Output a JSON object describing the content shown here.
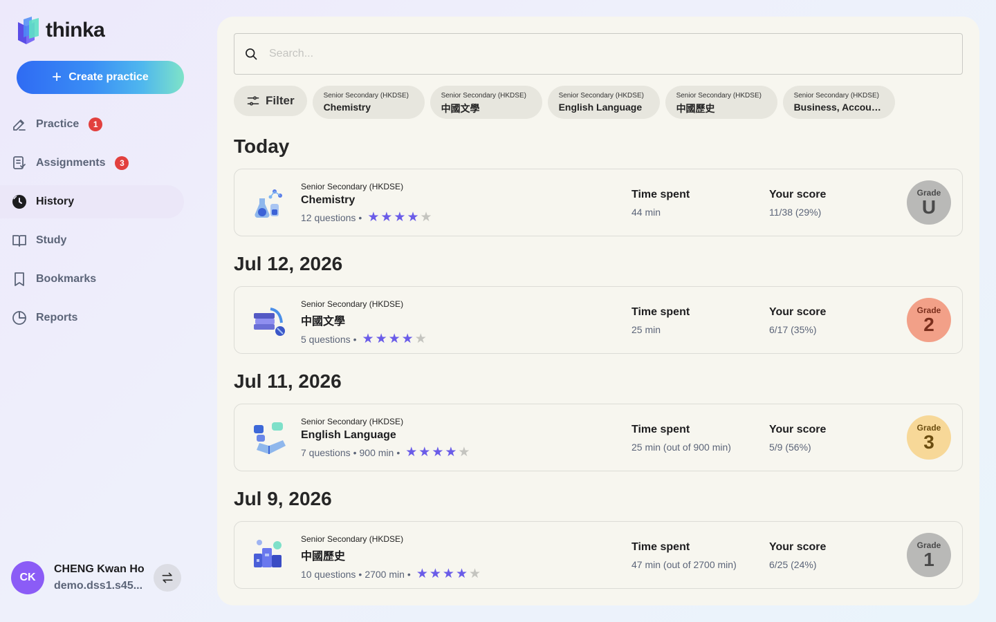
{
  "app": {
    "name": "thinka"
  },
  "sidebar": {
    "create_label": "Create practice",
    "items": [
      {
        "label": "Practice",
        "badge": "1"
      },
      {
        "label": "Assignments",
        "badge": "3"
      },
      {
        "label": "History",
        "badge": null
      },
      {
        "label": "Study",
        "badge": null
      },
      {
        "label": "Bookmarks",
        "badge": null
      },
      {
        "label": "Reports",
        "badge": null
      }
    ],
    "active": "History"
  },
  "user": {
    "initials": "CK",
    "name": "CHENG Kwan Ho",
    "email": "demo.dss1.s45..."
  },
  "search": {
    "placeholder": "Search..."
  },
  "filters": {
    "filter_label": "Filter",
    "chips": [
      {
        "level": "Senior Secondary (HKDSE)",
        "subject": "Chemistry"
      },
      {
        "level": "Senior Secondary (HKDSE)",
        "subject": "中國文學"
      },
      {
        "level": "Senior Secondary (HKDSE)",
        "subject": "English Language"
      },
      {
        "level": "Senior Secondary (HKDSE)",
        "subject": "中國歷史"
      },
      {
        "level": "Senior Secondary (HKDSE)",
        "subject": "Business, Accountin..."
      }
    ]
  },
  "history": [
    {
      "date": "Today",
      "level": "Senior Secondary (HKDSE)",
      "subject": "Chemistry",
      "questions": "12 questions",
      "duration": "",
      "stars": 4,
      "time_label": "Time spent",
      "time_value": "44 min",
      "score_label": "Your score",
      "score_value": "11/38 (29%)",
      "grade_label": "Grade",
      "grade": "U",
      "grade_bg": "#b9b9b7",
      "grade_fg": "#4a4a4a"
    },
    {
      "date": "Jul 12, 2026",
      "level": "Senior Secondary (HKDSE)",
      "subject": " 中國文學",
      "questions": "5 questions",
      "duration": "",
      "stars": 4,
      "time_label": "Time spent",
      "time_value": "25 min",
      "score_label": "Your score",
      "score_value": "6/17 (35%)",
      "grade_label": "Grade",
      "grade": "2",
      "grade_bg": "#f2a088",
      "grade_fg": "#7a2e1c"
    },
    {
      "date": "Jul 11, 2026",
      "level": "Senior Secondary (HKDSE)",
      "subject": "English Language",
      "questions": "7 questions",
      "duration": "900 min",
      "stars": 4,
      "time_label": "Time spent",
      "time_value": "25 min (out of 900 min)",
      "score_label": "Your score",
      "score_value": "5/9 (56%)",
      "grade_label": "Grade",
      "grade": "3",
      "grade_bg": "#f7d898",
      "grade_fg": "#6b4d10"
    },
    {
      "date": "Jul 9, 2026",
      "level": "Senior Secondary (HKDSE)",
      "subject": "中國歷史",
      "questions": "10 questions",
      "duration": "2700 min",
      "stars": 4,
      "time_label": "Time spent",
      "time_value": "47 min (out of 2700 min)",
      "score_label": "Your score",
      "score_value": "6/25 (24%)",
      "grade_label": "Grade",
      "grade": "1",
      "grade_bg": "#b9b9b7",
      "grade_fg": "#4a4a4a"
    }
  ],
  "icons": {
    "logo": "thinka-logo-icon",
    "nav": [
      "pencil-icon",
      "clipboard-icon",
      "history-icon",
      "book-open-icon",
      "bookmark-icon",
      "pie-chart-icon"
    ],
    "search": "search-icon",
    "filter": "sliders-icon",
    "switch": "swap-arrows-icon",
    "subjects": [
      "chemistry-flask-icon",
      "books-icon",
      "language-chat-icon",
      "history-city-icon"
    ]
  },
  "colors": {
    "accent": "#6a5ce8",
    "badge": "#e2403e",
    "avatar": "#8b5cf6"
  }
}
